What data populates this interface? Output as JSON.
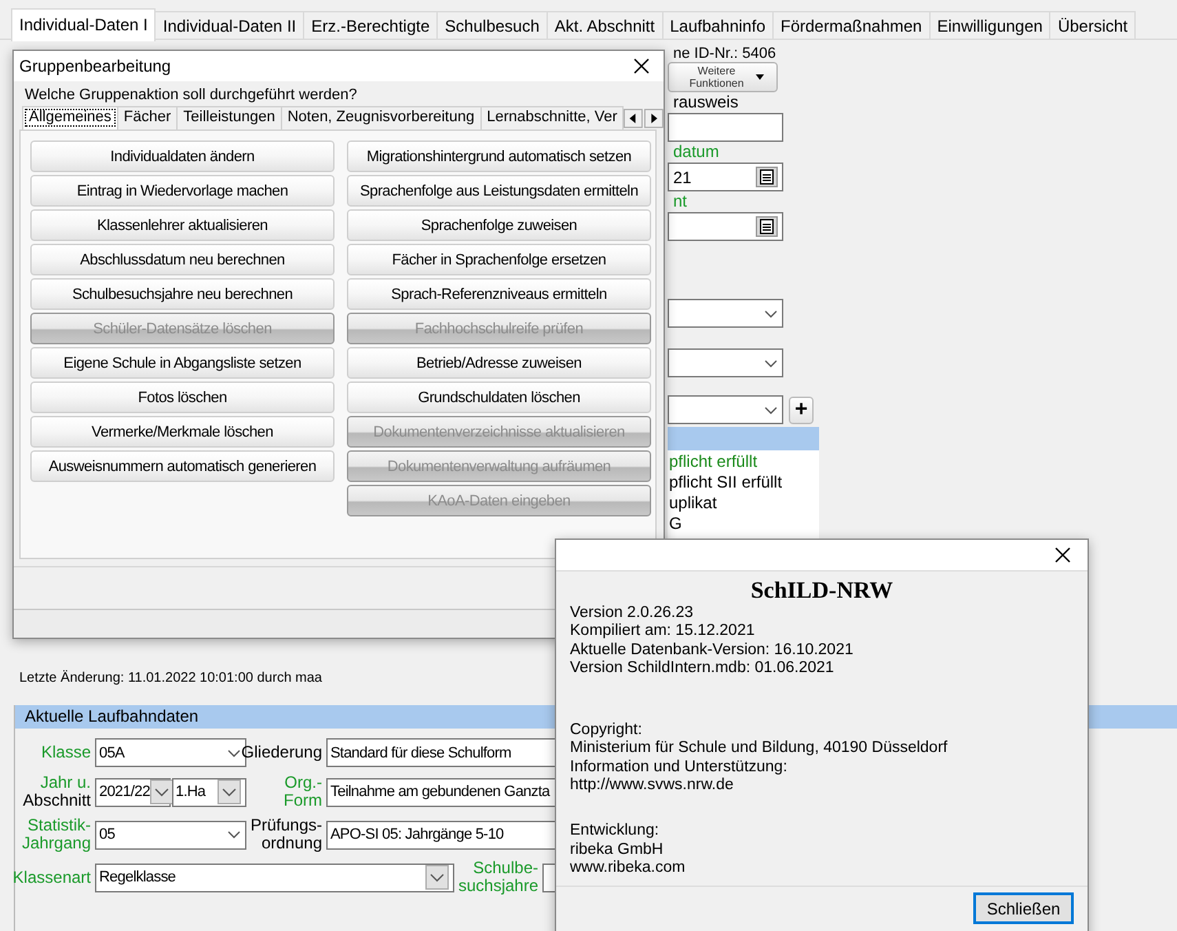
{
  "main_tabs": [
    {
      "label": "Individual-Daten I",
      "selected": true
    },
    {
      "label": "Individual-Daten II",
      "selected": false
    },
    {
      "label": "Erz.-Berechtigte",
      "selected": false
    },
    {
      "label": "Schulbesuch",
      "selected": false
    },
    {
      "label": "Akt. Abschnitt",
      "selected": false
    },
    {
      "label": "Laufbahninfo",
      "selected": false
    },
    {
      "label": "Fördermaßnahmen",
      "selected": false
    },
    {
      "label": "Einwilligungen",
      "selected": false
    },
    {
      "label": "Übersicht",
      "selected": false
    }
  ],
  "student_panel": {
    "id_text": "ne ID-Nr.: 5406",
    "more_button": "Weitere Funktionen",
    "items": [
      {
        "kind": "label",
        "text": "rausweis",
        "highlighted": false
      },
      {
        "kind": "text"
      },
      {
        "kind": "label",
        "text": "datum",
        "highlighted": true
      },
      {
        "kind": "date",
        "value": "21"
      },
      {
        "kind": "label",
        "text": "nt",
        "highlighted": true
      },
      {
        "kind": "date"
      },
      {
        "kind": "combo"
      },
      {
        "kind": "combo"
      },
      {
        "kind": "combo_add",
        "add_button": "+"
      }
    ],
    "list": [
      {
        "text": "pflicht erfüllt",
        "highlighted": true
      },
      {
        "text": "pflicht SII erfüllt",
        "highlighted": false
      },
      {
        "text": "uplikat",
        "highlighted": false
      },
      {
        "text": "G",
        "highlighted": false
      }
    ],
    "last_change": "Letzte Änderung: 11.01.2022 10:01:00 durch maa"
  },
  "career": {
    "title": "Aktuelle Laufbahndaten",
    "rows": [
      [
        {
          "label": [
            {
              "text": "Klasse",
              "highlighted": true
            }
          ],
          "controls": [
            {
              "kind": "combo",
              "value": "05A"
            }
          ]
        },
        {
          "label": [
            {
              "text": "Gliederung",
              "highlighted": false
            }
          ],
          "controls": [
            {
              "kind": "text",
              "value": "Standard für diese Schulform"
            }
          ]
        }
      ],
      [
        {
          "label": [
            {
              "text": "Jahr u.",
              "highlighted": true
            },
            {
              "text": "Abschnitt",
              "highlighted": false
            }
          ],
          "controls": [
            {
              "kind": "combo_boxed",
              "value": "2021/22"
            },
            {
              "kind": "combo_boxed",
              "value": "1.Ha"
            }
          ]
        },
        {
          "label": [
            {
              "text": "Org.-",
              "highlighted": true
            },
            {
              "text": "Form",
              "highlighted": true
            }
          ],
          "controls": [
            {
              "kind": "text",
              "value": "Teilnahme am gebundenen Ganzta"
            }
          ]
        }
      ],
      [
        {
          "label": [
            {
              "text": "Statistik-",
              "highlighted": true
            },
            {
              "text": "Jahrgang",
              "highlighted": true
            }
          ],
          "controls": [
            {
              "kind": "combo",
              "value": "05"
            }
          ]
        },
        {
          "label": [
            {
              "text": "Prüfungs-",
              "highlighted": false
            },
            {
              "text": "ordnung",
              "highlighted": false
            }
          ],
          "controls": [
            {
              "kind": "text",
              "value": "APO-SI 05: Jahrgänge 5-10"
            }
          ]
        }
      ],
      [
        {
          "label": [
            {
              "text": "Klassenart",
              "highlighted": true
            }
          ],
          "controls": [
            {
              "kind": "combo_boxed",
              "value": "Regelklasse"
            }
          ]
        },
        {
          "label": [
            {
              "text": "Schulbe-",
              "highlighted": true
            },
            {
              "text": "suchsjahre",
              "highlighted": true
            }
          ],
          "controls": [
            {
              "kind": "text"
            }
          ]
        }
      ]
    ]
  },
  "group_dialog": {
    "title": "Gruppenbearbeitung",
    "prompt": "Welche Gruppenaktion soll durchgeführt werden?",
    "tabs": [
      {
        "label": "Allgemeines",
        "selected": true
      },
      {
        "label": "Fächer",
        "selected": false
      },
      {
        "label": "Teilleistungen",
        "selected": false
      },
      {
        "label": "Noten, Zeugnisvorbereitung",
        "selected": false
      },
      {
        "label": "Lernabschnitte, Ver",
        "selected": false
      }
    ],
    "columns": [
      [
        {
          "label": "Individualdaten ändern",
          "disabled": false
        },
        {
          "label": "Eintrag in Wiedervorlage machen",
          "disabled": false
        },
        {
          "label": "Klassenlehrer aktualisieren",
          "disabled": false
        },
        {
          "label": "Abschlussdatum neu berechnen",
          "disabled": false
        },
        {
          "label": "Schulbesuchsjahre neu berechnen",
          "disabled": false
        },
        {
          "label": "Schüler-Datensätze löschen",
          "disabled": true
        },
        {
          "label": "Eigene Schule in Abgangsliste setzen",
          "disabled": false
        },
        {
          "label": "Fotos löschen",
          "disabled": false
        },
        {
          "label": "Vermerke/Merkmale löschen",
          "disabled": false
        },
        {
          "label": "Ausweisnummern automatisch generieren",
          "disabled": false
        }
      ],
      [
        {
          "label": "Migrationshintergrund automatisch setzen",
          "disabled": false
        },
        {
          "label": "Sprachenfolge aus Leistungsdaten ermitteln",
          "disabled": false
        },
        {
          "label": "Sprachenfolge zuweisen",
          "disabled": false
        },
        {
          "label": "Fächer in Sprachenfolge ersetzen",
          "disabled": false
        },
        {
          "label": "Sprach-Referenzniveaus ermitteln",
          "disabled": false
        },
        {
          "label": "Fachhochschulreife prüfen",
          "disabled": true
        },
        {
          "label": "Betrieb/Adresse zuweisen",
          "disabled": false
        },
        {
          "label": "Grundschuldaten löschen",
          "disabled": false
        },
        {
          "label": "Dokumentenverzeichnisse aktualisieren",
          "disabled": true
        },
        {
          "label": "Dokumentenverwaltung aufräumen",
          "disabled": true
        },
        {
          "label": "KAoA-Daten eingeben",
          "disabled": true
        }
      ]
    ]
  },
  "about_dialog": {
    "heading": "SchILD-NRW",
    "groups": [
      [
        "Version 2.0.26.23",
        "Kompiliert am: 15.12.2021",
        "Aktuelle Datenbank-Version: 16.10.2021",
        "Version SchildIntern.mdb: 01.06.2021"
      ],
      [
        "Copyright:",
        "Ministerium für Schule und Bildung, 40190 Düsseldorf",
        "Information und Unterstützung:",
        "http://www.svws.nrw.de"
      ],
      [
        "Entwicklung:",
        "ribeka GmbH",
        "www.ribeka.com"
      ]
    ],
    "button": "Schließen"
  }
}
